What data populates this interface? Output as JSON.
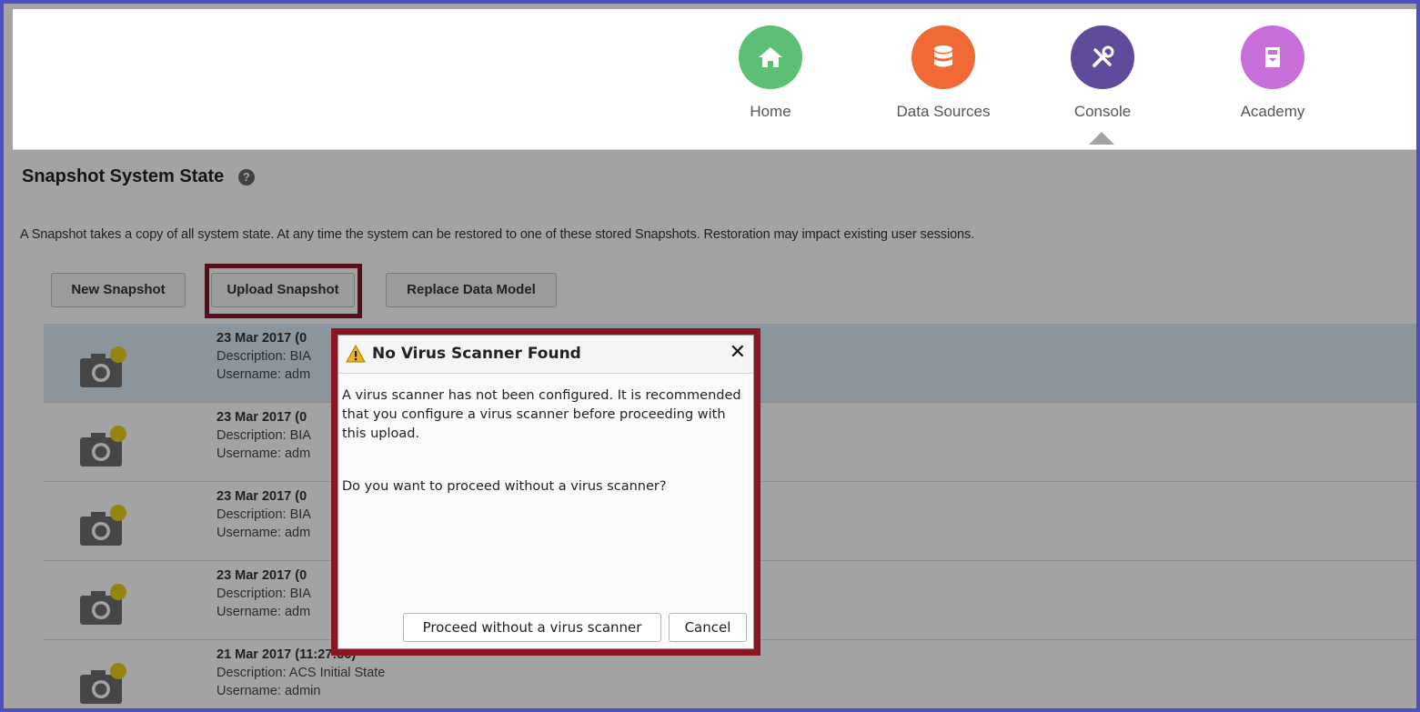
{
  "nav": {
    "items": [
      {
        "label": "Home",
        "icon": "home-icon",
        "color": "#5cbf74"
      },
      {
        "label": "Data Sources",
        "icon": "database-icon",
        "color": "#ef6a35"
      },
      {
        "label": "Console",
        "icon": "tools-icon",
        "color": "#5f4a9b"
      },
      {
        "label": "Academy",
        "icon": "academy-icon",
        "color": "#c96fdb"
      }
    ],
    "active": "Console"
  },
  "page": {
    "title": "Snapshot System State",
    "description": "A Snapshot takes a copy of all system state. At any time the system can be restored to one of these stored Snapshots. Restoration may impact existing user sessions."
  },
  "toolbar": {
    "new_snapshot": "New Snapshot",
    "upload_snapshot": "Upload Snapshot",
    "replace_data_model": "Replace Data Model"
  },
  "snapshots": [
    {
      "date": "23 Mar 2017 (0",
      "description": "Description: BIA",
      "username": "Username: adm"
    },
    {
      "date": "23 Mar 2017 (0",
      "description": "Description: BIA",
      "username": "Username: adm"
    },
    {
      "date": "23 Mar 2017 (0",
      "description": "Description: BIA",
      "username": "Username: adm"
    },
    {
      "date": "23 Mar 2017 (0",
      "description": "Description: BIA",
      "username": "Username: adm"
    },
    {
      "date": "21 Mar 2017 (11:27:36)",
      "description": "Description: ACS Initial State",
      "username": "Username: admin"
    }
  ],
  "dialog": {
    "title": "No Virus Scanner Found",
    "message": "A virus scanner has not been configured. It is recommended that you configure a virus scanner before proceeding with this upload.",
    "question": "Do you want to proceed without a virus scanner?",
    "proceed_label": "Proceed without a virus scanner",
    "cancel_label": "Cancel",
    "close_glyph": "✕"
  },
  "colors": {
    "frame_border": "#4a4fc4",
    "highlight": "#8b1523",
    "selected_row": "#dce9f5"
  }
}
